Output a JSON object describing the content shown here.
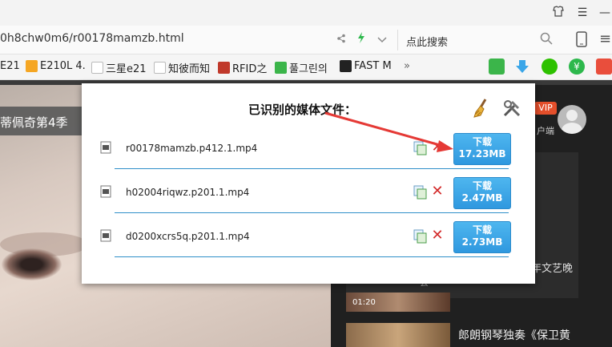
{
  "browser": {
    "url": "0h8chw0m6/r00178mamzb.html",
    "search_placeholder": "点此搜索"
  },
  "bookmarks": [
    {
      "label": "E21",
      "color": "#e94e3c"
    },
    {
      "label": "E210L 4.",
      "color": "#f5a623"
    },
    {
      "label": "三星e21",
      "color": "#cfcfcf"
    },
    {
      "label": "知彼而知",
      "color": "#cfcfcf"
    },
    {
      "label": "RFID之",
      "color": "#c0392b"
    },
    {
      "label": "풀그린의",
      "color": "#3bb54a"
    },
    {
      "label": "FAST M",
      "color": "#222222"
    }
  ],
  "bookmarks_more": "»",
  "page": {
    "episode_title": "蒂佩奇第4季",
    "vip_badge": "VIP",
    "client_text": "户端",
    "side_item1": "年文艺晚",
    "side_item1_sub": "会",
    "thumb1_time": "01:20",
    "side_item2": "郎朗钢琴独奏《保卫黄"
  },
  "popup": {
    "title": "已识别的媒体文件：",
    "files": [
      {
        "name": "r00178mamzb.p412.1.mp4",
        "download_label": "下载",
        "size": "17.23MB"
      },
      {
        "name": "h02004riqwz.p201.1.mp4",
        "download_label": "下载",
        "size": "2.47MB"
      },
      {
        "name": "d0200xcrs5q.p201.1.mp4",
        "download_label": "下载",
        "size": "2.73MB"
      }
    ]
  },
  "colors": {
    "accent_blue": "#3aa6e8",
    "delete_red": "#d32a2a",
    "arrow_red": "#e53935"
  }
}
